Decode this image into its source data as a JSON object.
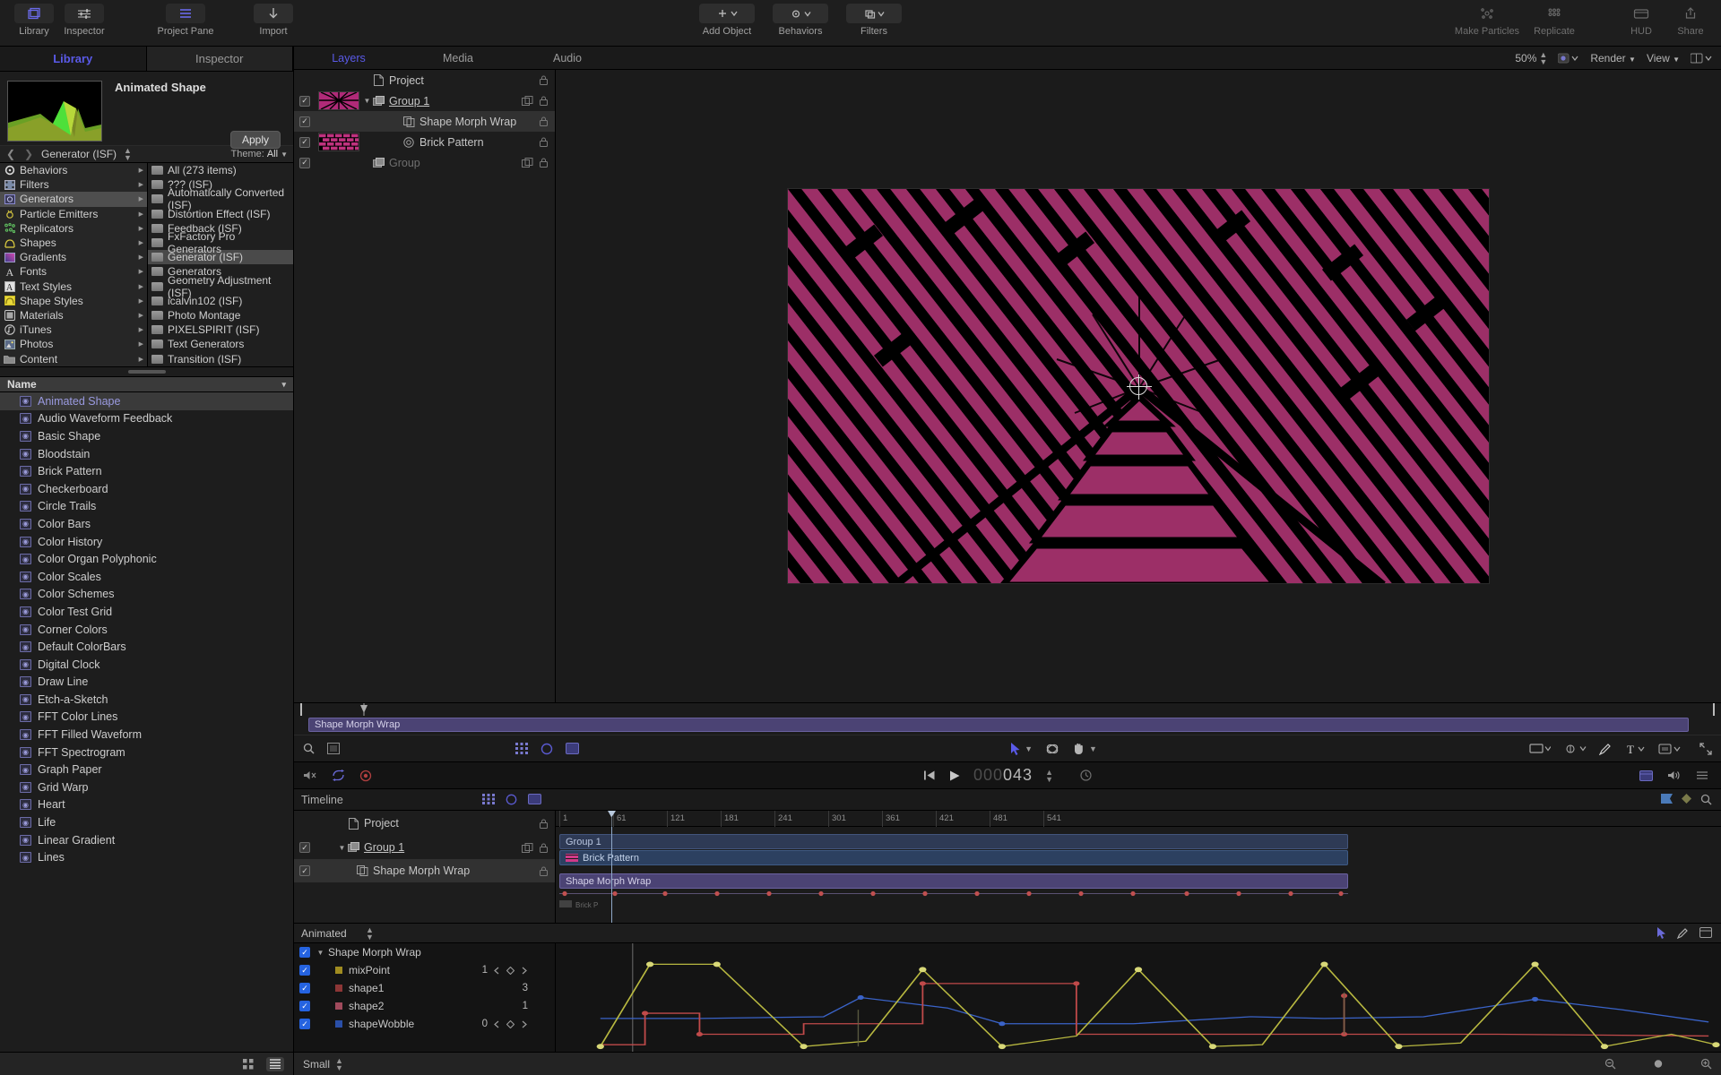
{
  "app": {
    "name": "Motion"
  },
  "toolbar": {
    "left_items": [
      {
        "label": "Library",
        "icon": "library-icon",
        "active": true
      },
      {
        "label": "Inspector",
        "icon": "inspector-icon",
        "active": true
      }
    ],
    "project_pane": {
      "label": "Project Pane",
      "icon": "project-pane-icon"
    },
    "import": {
      "label": "Import",
      "icon": "import-icon"
    },
    "center_items": [
      {
        "label": "Add Object",
        "icon": "plus-icon"
      },
      {
        "label": "Behaviors",
        "icon": "gear-icon"
      },
      {
        "label": "Filters",
        "icon": "filters-icon"
      }
    ],
    "right_items": [
      {
        "label": "Make Particles",
        "icon": "particles-icon"
      },
      {
        "label": "Replicate",
        "icon": "replicate-icon"
      },
      {
        "label": "HUD",
        "icon": "hud-icon"
      },
      {
        "label": "Share",
        "icon": "share-icon"
      }
    ]
  },
  "library": {
    "tabs": [
      {
        "label": "Library",
        "active": true
      },
      {
        "label": "Inspector",
        "active": false
      }
    ],
    "selected_title": "Animated Shape",
    "apply_label": "Apply",
    "path_title": "Generator (ISF)",
    "theme_label": "Theme:",
    "theme_value": "All",
    "categories": [
      {
        "label": "Behaviors",
        "icon": "behaviors-icon",
        "selected": false
      },
      {
        "label": "Filters",
        "icon": "filters-icon",
        "selected": false
      },
      {
        "label": "Generators",
        "icon": "generators-icon",
        "selected": true
      },
      {
        "label": "Particle Emitters",
        "icon": "particle-emitters-icon",
        "selected": false
      },
      {
        "label": "Replicators",
        "icon": "replicators-icon",
        "selected": false
      },
      {
        "label": "Shapes",
        "icon": "shapes-icon",
        "selected": false
      },
      {
        "label": "Gradients",
        "icon": "gradients-icon",
        "selected": false
      },
      {
        "label": "Fonts",
        "icon": "fonts-icon",
        "selected": false
      },
      {
        "label": "Text Styles",
        "icon": "text-styles-icon",
        "selected": false
      },
      {
        "label": "Shape Styles",
        "icon": "shape-styles-icon",
        "selected": false
      },
      {
        "label": "Materials",
        "icon": "materials-icon",
        "selected": false
      },
      {
        "label": "iTunes",
        "icon": "itunes-icon",
        "selected": false
      },
      {
        "label": "Photos",
        "icon": "photos-icon",
        "selected": false
      },
      {
        "label": "Content",
        "icon": "content-icon",
        "selected": false
      }
    ],
    "subcategories": [
      {
        "label": "All (273 items)",
        "selected": false
      },
      {
        "label": "??? (ISF)",
        "selected": false
      },
      {
        "label": "Automatically Converted (ISF)",
        "selected": false
      },
      {
        "label": "Distortion Effect (ISF)",
        "selected": false
      },
      {
        "label": "Feedback (ISF)",
        "selected": false
      },
      {
        "label": "FxFactory Pro Generators",
        "selected": false
      },
      {
        "label": "Generator (ISF)",
        "selected": true
      },
      {
        "label": "Generators",
        "selected": false
      },
      {
        "label": "Geometry Adjustment (ISF)",
        "selected": false
      },
      {
        "label": "icalvin102 (ISF)",
        "selected": false
      },
      {
        "label": "Photo Montage",
        "selected": false
      },
      {
        "label": "PIXELSPIRIT (ISF)",
        "selected": false
      },
      {
        "label": "Text Generators",
        "selected": false
      },
      {
        "label": "Transition (ISF)",
        "selected": false
      }
    ],
    "list_header": "Name",
    "items": [
      {
        "label": "Animated Shape",
        "selected": true
      },
      {
        "label": "Audio Waveform Feedback",
        "selected": false
      },
      {
        "label": "Basic Shape",
        "selected": false
      },
      {
        "label": "Bloodstain",
        "selected": false
      },
      {
        "label": "Brick Pattern",
        "selected": false
      },
      {
        "label": "Checkerboard",
        "selected": false
      },
      {
        "label": "Circle Trails",
        "selected": false
      },
      {
        "label": "Color Bars",
        "selected": false
      },
      {
        "label": "Color History",
        "selected": false
      },
      {
        "label": "Color Organ Polyphonic",
        "selected": false
      },
      {
        "label": "Color Scales",
        "selected": false
      },
      {
        "label": "Color Schemes",
        "selected": false
      },
      {
        "label": "Color Test Grid",
        "selected": false
      },
      {
        "label": "Corner Colors",
        "selected": false
      },
      {
        "label": "Default ColorBars",
        "selected": false
      },
      {
        "label": "Digital Clock",
        "selected": false
      },
      {
        "label": "Draw Line",
        "selected": false
      },
      {
        "label": "Etch-a-Sketch",
        "selected": false
      },
      {
        "label": "FFT Color Lines",
        "selected": false
      },
      {
        "label": "FFT Filled Waveform",
        "selected": false
      },
      {
        "label": "FFT Spectrogram",
        "selected": false
      },
      {
        "label": "Graph Paper",
        "selected": false
      },
      {
        "label": "Grid Warp",
        "selected": false
      },
      {
        "label": "Heart",
        "selected": false
      },
      {
        "label": "Life",
        "selected": false
      },
      {
        "label": "Linear Gradient",
        "selected": false
      },
      {
        "label": "Lines",
        "selected": false
      }
    ]
  },
  "layers_panel": {
    "tabs": [
      {
        "label": "Layers",
        "active": true
      },
      {
        "label": "Media",
        "active": false
      },
      {
        "label": "Audio",
        "active": false
      }
    ],
    "zoom": "50%",
    "render_label": "Render",
    "view_label": "View",
    "rows": [
      {
        "name": "Project",
        "icon": "project-icon",
        "checked": null,
        "thumb": null,
        "selected": false,
        "dim": false,
        "indent": 0,
        "disclosure": ""
      },
      {
        "name": "Group 1",
        "icon": "group-icon",
        "checked": true,
        "thumb": "morph",
        "selected": false,
        "dim": false,
        "indent": 0,
        "disclosure": "down"
      },
      {
        "name": "Shape Morph Wrap",
        "icon": "filter-icon",
        "checked": true,
        "thumb": null,
        "selected": true,
        "dim": false,
        "indent": 1,
        "disclosure": ""
      },
      {
        "name": "Brick Pattern",
        "icon": "generator-icon",
        "checked": true,
        "thumb": "brick",
        "selected": false,
        "dim": false,
        "indent": 1,
        "disclosure": ""
      },
      {
        "name": "Group",
        "icon": "group-icon",
        "checked": true,
        "thumb": null,
        "selected": false,
        "dim": true,
        "indent": 0,
        "disclosure": ""
      }
    ]
  },
  "mini_timeline": {
    "clip_label": "Shape Morph Wrap"
  },
  "transport": {
    "timecode_visible": "000043",
    "timecode_dim": "000",
    "timecode_active": "043"
  },
  "timeline": {
    "title": "Timeline",
    "ruler_ticks": [
      "1",
      "61",
      "121",
      "181",
      "241",
      "301",
      "361",
      "421",
      "481",
      "541"
    ],
    "rows": [
      {
        "name": "Project",
        "icon": "project-icon",
        "checked": null,
        "disclosure": ""
      },
      {
        "name": "Group 1",
        "icon": "group-icon",
        "checked": true,
        "disclosure": "down"
      },
      {
        "name": "Shape Morph Wrap",
        "icon": "filter-icon",
        "checked": true,
        "disclosure": ""
      }
    ],
    "bars": [
      {
        "label": "Group 1",
        "kind": "grp"
      },
      {
        "label": "Brick Pattern",
        "kind": "brick"
      },
      {
        "label": "Shape Morph Wrap",
        "kind": "morph"
      }
    ]
  },
  "keyframe_editor": {
    "filter_label": "Animated",
    "size_label": "Small",
    "parent": {
      "name": "Shape Morph Wrap",
      "checked": true
    },
    "parameters": [
      {
        "name": "mixPoint",
        "value": "1",
        "color": "#a08c20",
        "checked": true,
        "has_nav": true
      },
      {
        "name": "shape1",
        "value": "3",
        "color": "#8c3636",
        "checked": true,
        "has_nav": false
      },
      {
        "name": "shape2",
        "value": "1",
        "color": "#a04a5c",
        "checked": true,
        "has_nav": false
      },
      {
        "name": "shapeWobble",
        "value": "0",
        "color": "#2a4fa8",
        "checked": true,
        "has_nav": true
      }
    ]
  },
  "colors": {
    "accent": "#5a5ae8",
    "canvas_magenta": "#9c2f67",
    "canvas_black": "#000000",
    "clip_purple": "#4b4374",
    "clip_blue": "#2c4060",
    "checkbox_blue": "#2563e0"
  }
}
